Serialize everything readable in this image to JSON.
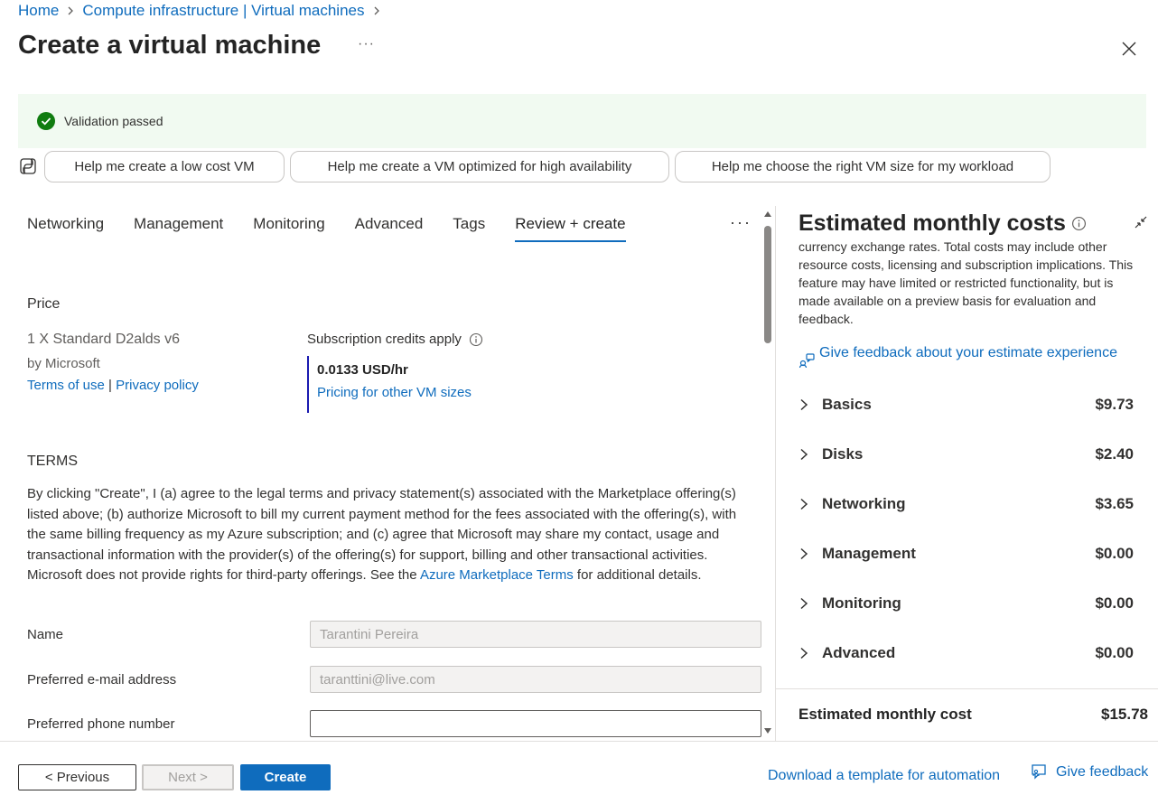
{
  "breadcrumb": {
    "items": [
      "Home",
      "Compute infrastructure | Virtual machines"
    ]
  },
  "page": {
    "title": "Create a virtual machine",
    "more": "···"
  },
  "validation": {
    "text": "Validation passed"
  },
  "copilot": {
    "prompts": [
      "Help me create a low cost VM",
      "Help me create a VM optimized for high availability",
      "Help me choose the right VM size for my workload"
    ]
  },
  "tabs": {
    "items": [
      "Networking",
      "Management",
      "Monitoring",
      "Advanced",
      "Tags",
      "Review + create"
    ],
    "active": "Review + create",
    "more": "···"
  },
  "price": {
    "heading": "Price",
    "product_name": "1 X Standard D2alds v6",
    "by": "by Microsoft",
    "terms_of_use": "Terms of use",
    "separator": "|",
    "privacy_policy": "Privacy policy",
    "credits_label": "Subscription credits apply",
    "rate": "0.0133 USD/hr",
    "pricing_link": "Pricing for other VM sizes"
  },
  "terms": {
    "heading": "TERMS",
    "body": "By clicking \"Create\", I (a) agree to the legal terms and privacy statement(s) associated with the Marketplace offering(s) listed above; (b) authorize Microsoft to bill my current payment method for the fees associated with the offering(s), with the same billing frequency as my Azure subscription; and (c) agree that Microsoft may share my contact, usage and transactional information with the provider(s) of the offering(s) for support, billing and other transactional activities. Microsoft does not provide rights for third-party offerings. See the ",
    "link": "Azure Marketplace Terms",
    "tail": " for additional details."
  },
  "form": {
    "name_label": "Name",
    "name_value": "Tarantini Pereira",
    "email_label": "Preferred e-mail address",
    "email_value": "taranttini@live.com",
    "phone_label": "Preferred phone number",
    "phone_value": ""
  },
  "costs": {
    "title": "Estimated monthly costs",
    "disclaimer": "currency exchange rates. Total costs may include other resource costs, licensing and subscription implications. This feature may have limited or restricted functionality, but is made available on a preview basis for evaluation and feedback.",
    "feedback_link": "Give feedback about your estimate experience",
    "rows": [
      {
        "label": "Basics",
        "amount": "$9.73"
      },
      {
        "label": "Disks",
        "amount": "$2.40"
      },
      {
        "label": "Networking",
        "amount": "$3.65"
      },
      {
        "label": "Management",
        "amount": "$0.00"
      },
      {
        "label": "Monitoring",
        "amount": "$0.00"
      },
      {
        "label": "Advanced",
        "amount": "$0.00"
      }
    ],
    "total_label": "Estimated monthly cost",
    "total_amount": "$15.78"
  },
  "footer": {
    "previous": "< Previous",
    "next": "Next >",
    "create": "Create",
    "template_link": "Download a template for automation",
    "feedback": "Give feedback"
  },
  "colors": {
    "accent": "#0f6cbd",
    "success": "#107c10",
    "validation_bg": "#f1faf1"
  },
  "icons": [
    "chevron-right-icon",
    "more-icon",
    "close-icon",
    "check-circle-icon",
    "copilot-icon",
    "info-icon",
    "collapse-icon",
    "feedback-icon"
  ]
}
